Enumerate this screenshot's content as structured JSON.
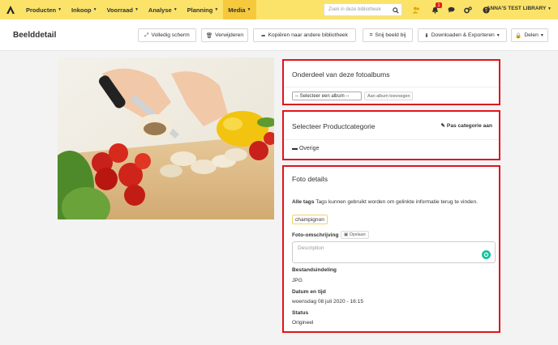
{
  "nav": {
    "items": [
      {
        "label": "Producten"
      },
      {
        "label": "Inkoop"
      },
      {
        "label": "Voorraad"
      },
      {
        "label": "Analyse"
      },
      {
        "label": "Planning"
      },
      {
        "label": "Media"
      }
    ],
    "active_item": "Media",
    "search_placeholder": "Zoek in deze bibliotheek",
    "notification_count": "1",
    "library_name": "ANNA'S TEST LIBRARY"
  },
  "header": {
    "title": "Beelddetail",
    "buttons": {
      "fullscreen": "Volledig scherm",
      "delete": "Verwijderen",
      "copy": "Kopiëren naar andere bibliotheek",
      "crop": "Snij beeld bij",
      "download": "Downloaden & Exporteren",
      "share": "Delen"
    }
  },
  "albums": {
    "title": "Onderdeel van deze fotoalbums",
    "select_value": "-- Selecteer een album --",
    "add_button": "Aan album toevoegen"
  },
  "category": {
    "title": "Selecteer Productcategorie",
    "edit_button": "Pas categorie aan",
    "value": "Overige"
  },
  "details": {
    "title": "Foto details",
    "tags_label": "Alle tags",
    "tags_help": "Tags kunnen gebruikt worden om gelinkte informatie terug te vinden.",
    "tag": "champignon",
    "description_label": "Foto-omschrijving",
    "save_button": "Opslaan",
    "description_placeholder": "Description",
    "format_label": "Bestandsindeling",
    "format_value": "JPG",
    "date_label": "Datum en tijd",
    "date_value": "woensdag 08 juli 2020 - 16:15",
    "status_label": "Status",
    "status_value": "Origineel"
  },
  "colors": {
    "nav_bg": "#fbe36a",
    "nav_active": "#f6c93c",
    "highlight": "#e0141b"
  }
}
